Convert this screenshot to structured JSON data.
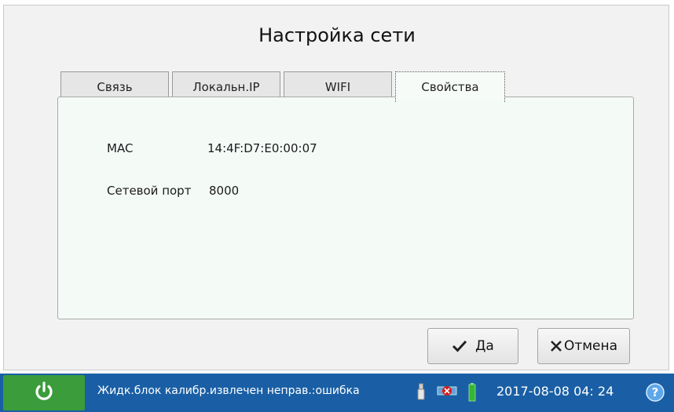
{
  "title": "Настройка сети",
  "tabs": [
    {
      "label": "Связь"
    },
    {
      "label": "Локальн.IP"
    },
    {
      "label": "WIFI"
    },
    {
      "label": "Свойства",
      "active": true
    }
  ],
  "properties": {
    "mac_label": "MAC",
    "mac_value": "14:4F:D7:E0:00:07",
    "port_label": "Сетевой порт",
    "port_value": "8000"
  },
  "buttons": {
    "ok_label": "Да",
    "cancel_label": "Отмена"
  },
  "statusbar": {
    "message": "Жидк.блок калибр.извлечен неправ.:ошибка",
    "datetime": "2017-08-08  04: 24",
    "icons": [
      "power-icon",
      "usb-icon",
      "network-error-icon",
      "battery-icon",
      "help-icon"
    ]
  },
  "colors": {
    "statusbar": "#1a5fa5",
    "power": "#3a9c3a",
    "panel": "#f4fbf7"
  }
}
